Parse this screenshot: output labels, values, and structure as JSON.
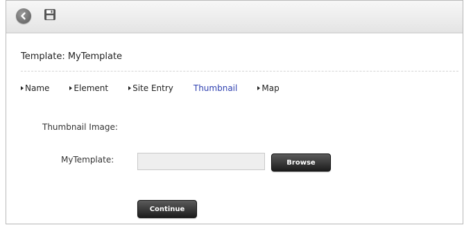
{
  "toolbar": {
    "back_icon": "back-arrow-icon",
    "save_icon": "floppy-disk-icon"
  },
  "page": {
    "title": "Template: MyTemplate"
  },
  "tabs": [
    {
      "label": "Name",
      "active": false
    },
    {
      "label": "Element",
      "active": false
    },
    {
      "label": "Site Entry",
      "active": false
    },
    {
      "label": "Thumbnail",
      "active": true
    },
    {
      "label": "Map",
      "active": false
    }
  ],
  "form": {
    "section_label": "Thumbnail Image:",
    "file_label": "MyTemplate:",
    "file_value": "",
    "browse_label": "Browse",
    "continue_label": "Continue"
  },
  "colors": {
    "active_tab": "#2d3fb0",
    "button_bg": "#1c1c1c"
  }
}
